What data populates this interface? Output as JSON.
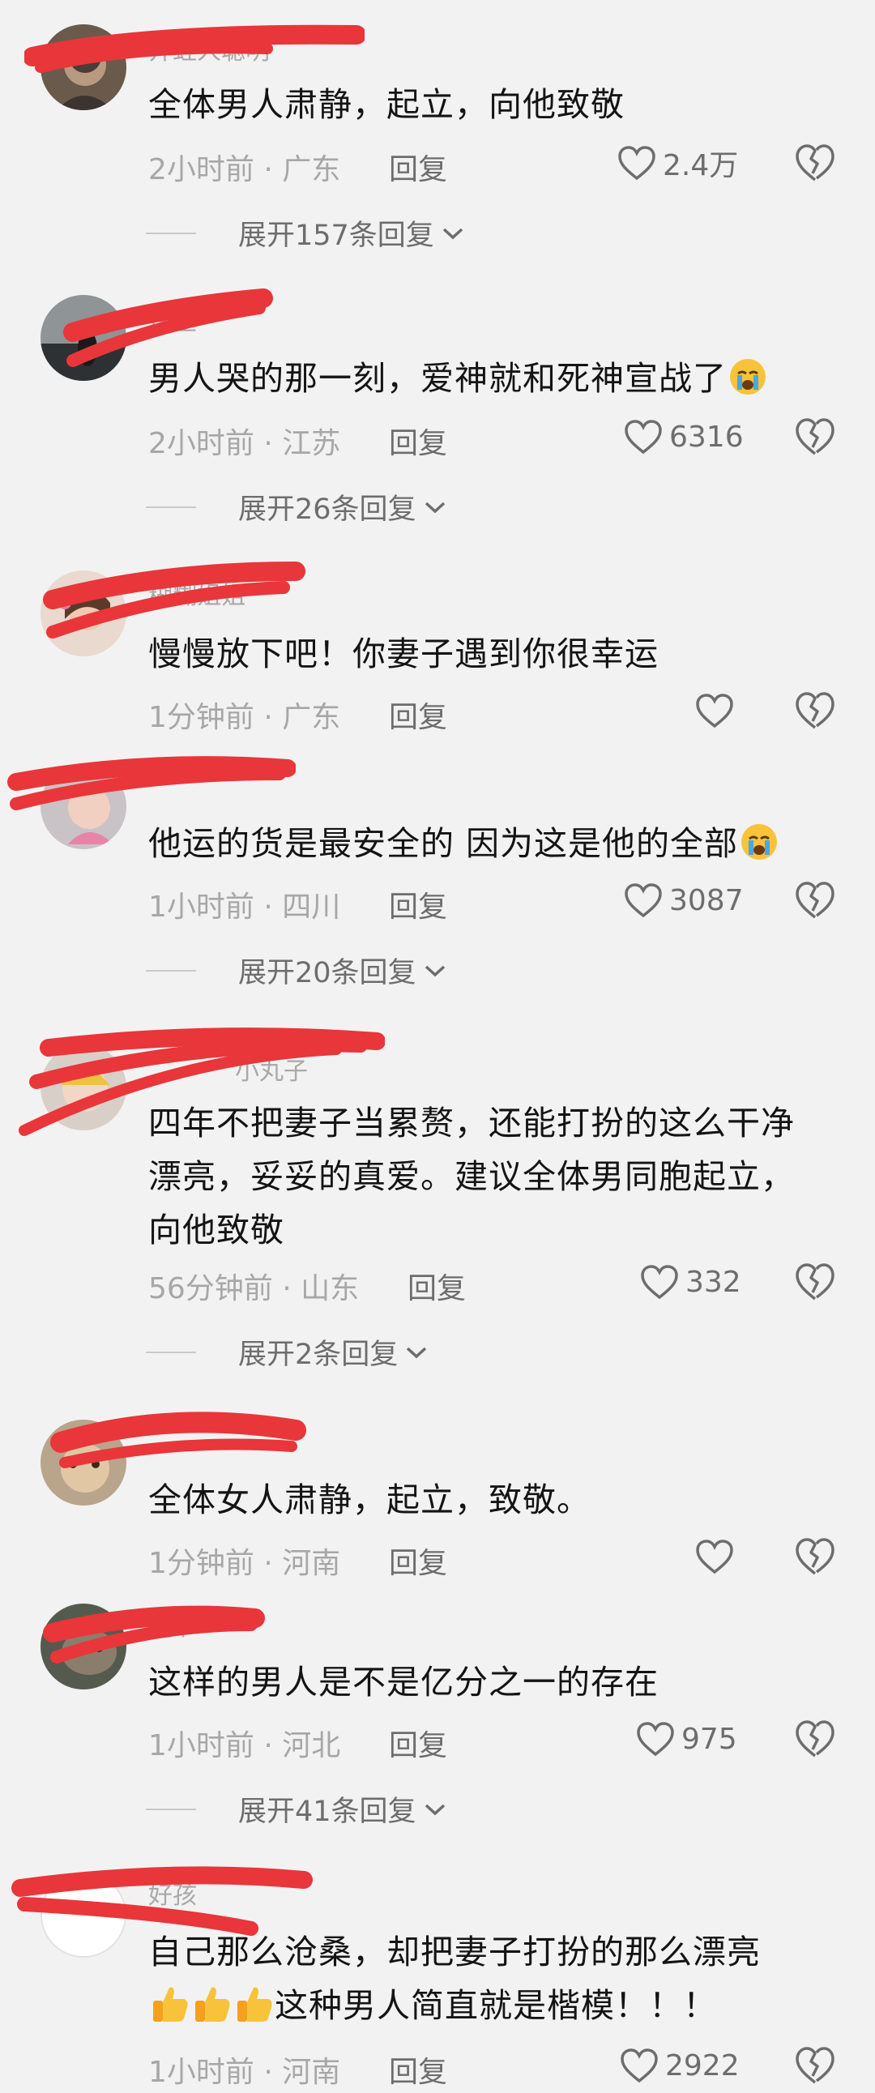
{
  "icons": {
    "like": "heart-outline-icon",
    "dislike": "broken-heart-icon",
    "expand": "chevron-down-icon"
  },
  "colors": {
    "background": "#f2f2f2",
    "text": "#141414",
    "muted": "#a7a7a7",
    "redaction": "#e8363a"
  },
  "comments": [
    {
      "name": "井蛙人聪明",
      "text": "全体男人肃静，起立，向他致敬",
      "time": "2小时前 · 广东",
      "reply": "回复",
      "likes": "2.4万",
      "expand": "展开157条回复"
    },
    {
      "name": "悦里",
      "text": "男人哭的那一刻，爱神就和死神宣战了",
      "time": "2小时前 · 江苏",
      "reply": "回复",
      "likes": "6316",
      "expand": "展开26条回复"
    },
    {
      "name": "糊糊姐姐",
      "text": "慢慢放下吧！你妻子遇到你很幸运",
      "time": "1分钟前 · 广东",
      "reply": "回复",
      "likes": ""
    },
    {
      "name": "",
      "text": "他运的货是最安全的 因为这是他的全部",
      "time": "1小时前 · 四川",
      "reply": "回复",
      "likes": "3087",
      "expand": "展开20条回复"
    },
    {
      "name": "小丸子",
      "text": "四年不把妻子当累赘，还能打扮的这么干净漂亮，妥妥的真爱。建议全体男同胞起立，向他致敬",
      "time": "56分钟前 · 山东",
      "reply": "回复",
      "likes": "332",
      "expand": "展开2条回复"
    },
    {
      "name": "",
      "text": "全体女人肃静，起立，致敬。",
      "time": "1分钟前 · 河南",
      "reply": "回复",
      "likes": ""
    },
    {
      "name": "猫爷",
      "text": "这样的男人是不是亿分之一的存在",
      "time": "1小时前 · 河北",
      "reply": "回复",
      "likes": "975",
      "expand": "展开41条回复"
    },
    {
      "name": "好孩",
      "text": "自己那么沧桑，却把妻子打扮的那么漂亮",
      "text2": "这种男人简直就是楷模！！！",
      "time": "1小时前 · 河南",
      "reply": "回复",
      "likes": "2922"
    }
  ]
}
